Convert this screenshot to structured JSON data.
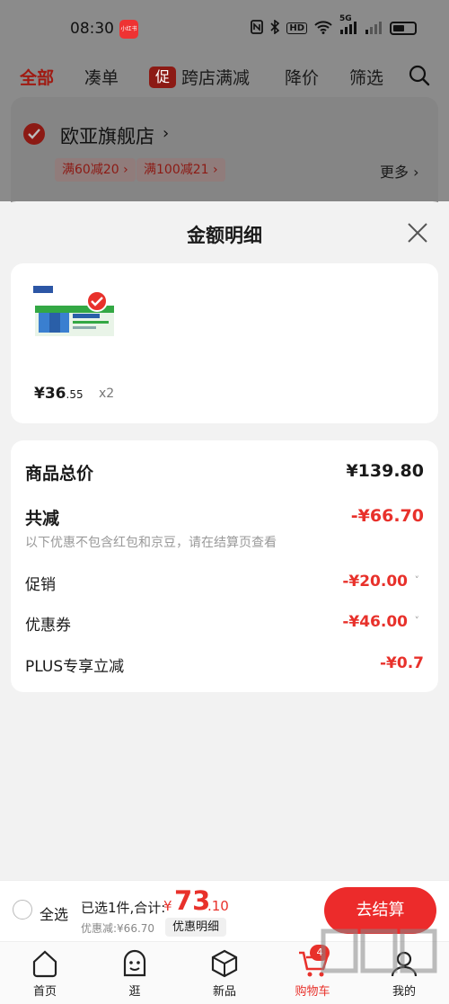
{
  "status_bar": {
    "time": "08:30",
    "badge_label": "小红书",
    "icons": [
      "nfc-icon",
      "bluetooth-icon",
      "hd-icon",
      "wifi-icon",
      "signal-5g-icon",
      "signal-icon",
      "battery-icon"
    ],
    "hd_label": "HD",
    "net_label": "5G"
  },
  "cart_header": {
    "tabs": [
      {
        "label": "全部",
        "active": true
      },
      {
        "label": "凑单"
      },
      {
        "label": "跨店满减",
        "badge": "促"
      },
      {
        "label": "降价"
      },
      {
        "label": "筛选"
      }
    ],
    "store": {
      "name": "欧亚旗舰店",
      "chevron": "›",
      "coupons": [
        "满60减20 ›",
        "满100减21 ›"
      ],
      "more": "更多 ›"
    }
  },
  "sheet": {
    "title": "金额明细",
    "product": {
      "price_main": "¥36",
      "price_decimal": ".55",
      "quantity": "x2",
      "image": "product-milk-box-image"
    },
    "details": {
      "total_label": "商品总价",
      "total_value": "¥139.80",
      "reduce_label": "共减",
      "reduce_value": "-¥66.70",
      "reduce_note": "以下优惠不包含红包和京豆，请在结算页查看",
      "promo_label": "促销",
      "promo_value": "-¥20.00",
      "coupon_label": "优惠券",
      "coupon_value": "-¥46.00",
      "plus_label": "PLUS专享立减",
      "plus_value": "-¥0.7",
      "chevron": "˅"
    }
  },
  "checkout": {
    "select_all": "全选",
    "selected_text": "已选1件,合计:",
    "currency": "¥",
    "total_int": "73",
    "total_dec": ".10",
    "discount_text": "优惠减:¥66.70",
    "discount_detail_button": "优惠明细",
    "checkout_button": "去结算"
  },
  "bottom_nav": [
    {
      "label": "首页",
      "icon": "home-icon"
    },
    {
      "label": "逛",
      "icon": "face-icon"
    },
    {
      "label": "新品",
      "icon": "box-icon"
    },
    {
      "label": "购物车",
      "icon": "cart-icon",
      "active": true,
      "count": "4"
    },
    {
      "label": "我的",
      "icon": "user-icon"
    }
  ],
  "colors": {
    "accent": "#e8312b",
    "dim_overlay": "#8b8b8b",
    "checkout_button": "#ec2b2b"
  }
}
